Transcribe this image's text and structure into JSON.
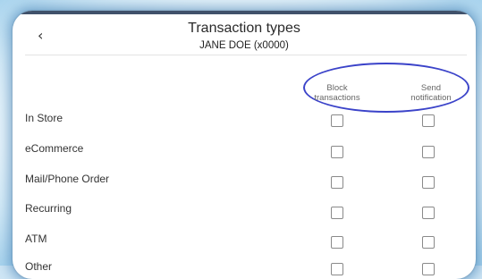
{
  "header": {
    "back_icon": "chevron-left-icon",
    "title": "Transaction types",
    "subtitle": "JANE DOE (x0000)"
  },
  "columns": {
    "block": [
      "Block",
      "transactions"
    ],
    "notify": [
      "Send",
      "notification"
    ]
  },
  "rows": [
    {
      "label": "In Store",
      "block": false,
      "notify": false
    },
    {
      "label": "eCommerce",
      "block": false,
      "notify": false
    },
    {
      "label": "Mail/Phone Order",
      "block": false,
      "notify": false
    },
    {
      "label": "Recurring",
      "block": false,
      "notify": false
    },
    {
      "label": "ATM",
      "block": false,
      "notify": false
    },
    {
      "label": "Other",
      "block": false,
      "notify": false
    }
  ],
  "colors": {
    "highlight_oval": "#3b43c9",
    "frame_glow": "#286eaa"
  }
}
